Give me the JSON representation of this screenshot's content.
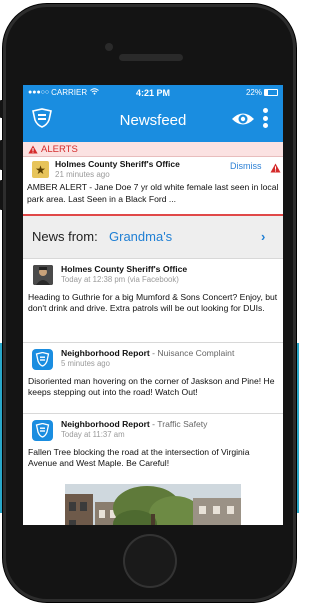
{
  "status_bar": {
    "carrier": "CARRIER",
    "time": "4:21 PM",
    "battery": "22%"
  },
  "header": {
    "title": "Newsfeed",
    "logo_icon": "shield-logo-icon",
    "eye_icon": "eye-icon",
    "menu_icon": "more-vertical-icon",
    "accent_color": "#1a8de0"
  },
  "alerts": {
    "section_label": "ALERTS",
    "alert_color": "#d42b2b",
    "item": {
      "source": "Holmes County Sheriff's Office",
      "time": "21 minutes ago",
      "dismiss_label": "Dismiss",
      "text": "AMBER ALERT - Jane Doe 7 yr old white female last seen in local park area. Last Seen in a Black Ford ..."
    }
  },
  "news_from": {
    "label": "News from:",
    "value": "Grandma's",
    "chevron": "›"
  },
  "posts": [
    {
      "source": "Holmes County Sheriff's Office",
      "category": "",
      "time": "Today at 12:38 pm (via Facebook)",
      "text": "Heading to Guthrie for a big Mumford & Sons Concert? Enjoy, but don't drink and drive. Extra patrols will be out looking for DUIs."
    },
    {
      "source": "Neighborhood Report",
      "category": " - Nuisance Complaint",
      "time": "5 minutes ago",
      "text": "Disoriented man hovering on the corner of Jaskson and Pine! He keeps stepping out into the road! Watch Out!"
    },
    {
      "source": "Neighborhood Report",
      "category": " - Traffic Safety",
      "time": "Today at 11:37 am",
      "text": "Fallen Tree blocking the road at the intersection of Virginia Avenue and West Maple. Be Careful!"
    }
  ]
}
